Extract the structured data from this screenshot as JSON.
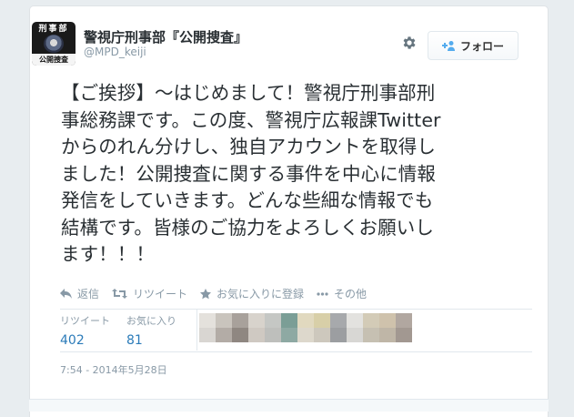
{
  "account": {
    "name": "警視庁刑事部『公開捜査』",
    "handle": "@MPD_keiji",
    "avatar_top_text": "刑事部",
    "avatar_bottom_text": "公開捜査"
  },
  "follow_button": {
    "label": "フォロー",
    "icon": "add-user-icon"
  },
  "tweet": {
    "lines": [
      "【ご挨拶】～はじめまして！警視庁刑事部刑",
      "事総務課です。この度、警視庁広報課Twitter",
      "からのれん分けし、独自アカウントを取得し",
      "ました！公開捜査に関する事件を中心に情報",
      "発信をしていきます。どんな些細な情報でも",
      "結構です。皆様のご協力をよろしくお願いし",
      "ます！！！"
    ]
  },
  "actions": {
    "reply": "返信",
    "retweet": "リツイート",
    "favorite": "お気に入りに登録",
    "more": "その他"
  },
  "stats": {
    "retweets_label": "リツイート",
    "retweets_count": "402",
    "favorites_label": "お気に入り",
    "favorites_count": "81"
  },
  "timestamp": "7:54 - 2014年5月28日",
  "colors": {
    "accent": "#55acee",
    "link": "#2b7bb9",
    "text": "#292f33",
    "muted": "#8899a6"
  },
  "blurred_faces_top": [
    "#e4e1dc",
    "#c9c4bd",
    "#a8a19b",
    "#d8d3cc",
    "#c5c7c4",
    "#7b9e96",
    "#e1d9bf",
    "#d8cfa8",
    "#a7a9ac",
    "#e3e2df",
    "#d3cbb7",
    "#cfc2ac",
    "#b1a7a0"
  ],
  "blurred_faces_bottom": [
    "#d9d6d2",
    "#b3aca6",
    "#8f8781",
    "#cfc9c2",
    "#bebfbc",
    "#8ea9a3",
    "#ddd8cc",
    "#cdc8bd",
    "#9c9ea1",
    "#d8d7d4",
    "#c6c0b2",
    "#bfb6a7",
    "#a29891"
  ]
}
